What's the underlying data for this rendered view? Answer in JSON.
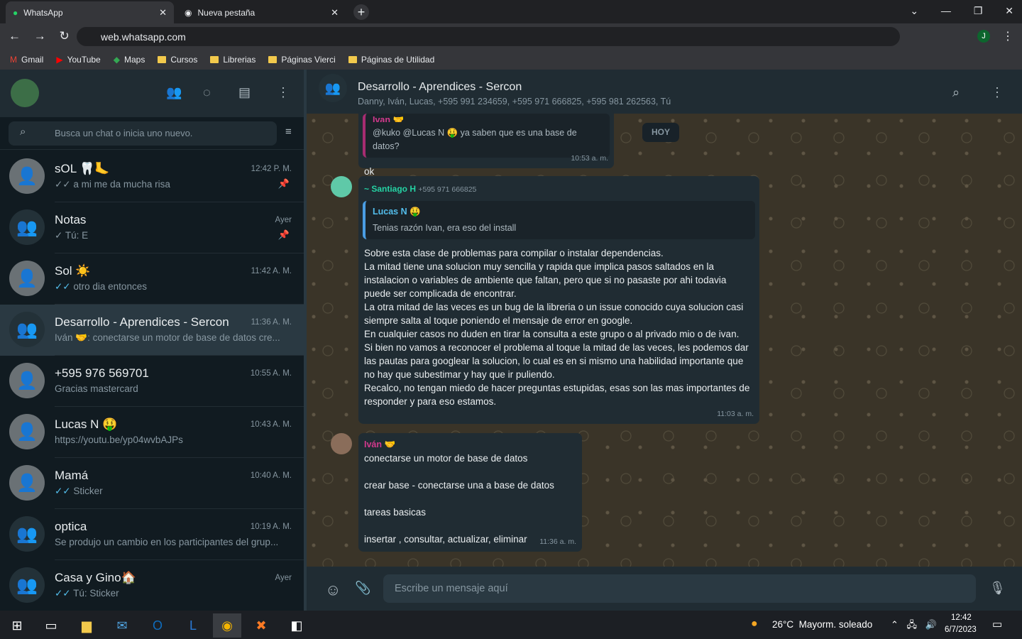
{
  "browser": {
    "tabs": [
      {
        "label": "WhatsApp"
      },
      {
        "label": "Nueva pestaña"
      }
    ],
    "url": "web.whatsapp.com",
    "profile_initial": "J",
    "bookmarks": [
      "Gmail",
      "YouTube",
      "Maps",
      "Cursos",
      "Librerias",
      "Páginas Vierci",
      "Páginas de Utilidad"
    ]
  },
  "sidebar": {
    "search_placeholder": "Busca un chat o inicia uno nuevo.",
    "chats": [
      {
        "name": "sOL 🦷🦶",
        "time": "12:42 P. M.",
        "preview": "a mi me da mucha risa",
        "ticks": "✓✓",
        "tick_color": "#8696a0",
        "pinned": true,
        "group": false
      },
      {
        "name": "Notas",
        "time": "Ayer",
        "preview": "Tú: E",
        "ticks": "✓",
        "tick_color": "#8696a0",
        "pinned": true,
        "group": true
      },
      {
        "name": "Sol ☀️",
        "time": "11:42 A. M.",
        "preview": "otro dia entonces",
        "ticks": "✓✓",
        "tick_color": "#53bdeb",
        "pinned": false,
        "group": false
      },
      {
        "name": "Desarrollo - Aprendices - Sercon",
        "time": "11:36 A. M.",
        "preview": "Iván 🤝: conectarse un motor de base de datos cre...",
        "ticks": "",
        "pinned": false,
        "group": true,
        "selected": true
      },
      {
        "name": "+595 976 569701",
        "time": "10:55 A. M.",
        "preview": "Gracias mastercard",
        "ticks": "",
        "pinned": false,
        "group": false
      },
      {
        "name": "Lucas N 🤑",
        "time": "10:43 A. M.",
        "preview": "https://youtu.be/yp04wvbAJPs",
        "ticks": "",
        "pinned": false,
        "group": false
      },
      {
        "name": "Mamá",
        "time": "10:40 A. M.",
        "preview": "Sticker",
        "ticks": "✓✓",
        "tick_color": "#53bdeb",
        "pinned": false,
        "group": false
      },
      {
        "name": "optica",
        "time": "10:19 A. M.",
        "preview": "Se produjo un cambio en los participantes del grup...",
        "ticks": "",
        "pinned": false,
        "group": true
      },
      {
        "name": "Casa y Gino🏠",
        "time": "Ayer",
        "preview": "Tú: Sticker",
        "ticks": "✓✓",
        "tick_color": "#53bdeb",
        "pinned": false,
        "group": true
      }
    ]
  },
  "conversation": {
    "title": "Desarrollo - Aprendices - Sercon",
    "members": "Danny, Iván, Lucas, +595 991 234659, +595 971 666825, +595 981 262563, Tú",
    "date_badge": "HOY",
    "msg1": {
      "quote_author": "Ivan 🤝",
      "quote_text": "@kuko @Lucas N 🤑 ya saben que es una base de datos?",
      "text": "ok",
      "time": "10:53 a. m."
    },
    "msg2": {
      "author": "~ Santiago H",
      "phone": "+595 971 666825",
      "quote_author": "Lucas N 🤑",
      "quote_text": "Tenias razón Ivan, era eso del install",
      "text": "Sobre esta clase de problemas para compilar o instalar dependencias.\nLa mitad tiene una solucion muy sencilla y rapida que implica pasos saltados en la instalacion o variables de ambiente que faltan, pero que si no pasaste por ahi todavia puede ser complicada de encontrar.\nLa otra mitad de las veces es un bug de la libreria o un issue conocido cuya solucion casi siempre salta al toque poniendo el mensaje de error en google.\nEn cualquier casos no duden en tirar la consulta a este grupo o al privado mio o de ivan.\nSi bien no vamos a reconocer el problema al toque la mitad de las veces, les podemos dar las pautas para googlear la solucion, lo cual es en si mismo una habilidad importante que no hay que subestimar y hay que ir puliendo.\nRecalco, no tengan miedo de hacer preguntas estupidas, esas son las mas importantes de responder y para eso estamos.",
      "time": "11:03 a. m."
    },
    "msg3": {
      "author": "Iván 🤝",
      "text": "conectarse un motor de base de datos\n\ncrear base - conectarse una a base de datos\n\ntareas basicas\n\ninsertar , consultar, actualizar, eliminar",
      "time": "11:36 a. m."
    },
    "input_placeholder": "Escribe un mensaje aquí"
  },
  "taskbar": {
    "weather": "26°C  Mayorm. soleado",
    "time": "12:42",
    "date": "6/7/2023"
  }
}
